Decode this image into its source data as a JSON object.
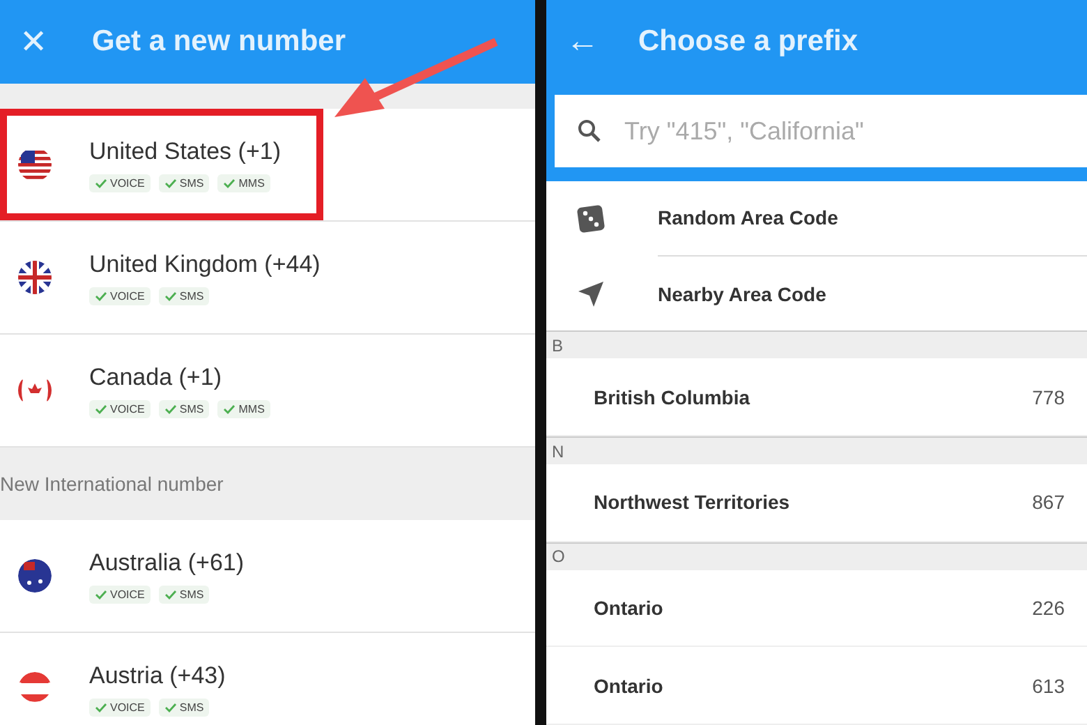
{
  "left_screen": {
    "title": "Get a new number",
    "close_icon": "✕",
    "sections": [
      {
        "countries": [
          {
            "name": "United States (+1)",
            "kind": "us",
            "highlighted": true,
            "features": [
              "VOICE",
              "SMS",
              "MMS"
            ]
          },
          {
            "name": "United Kingdom (+44)",
            "kind": "uk",
            "highlighted": false,
            "features": [
              "VOICE",
              "SMS"
            ]
          },
          {
            "name": "Canada (+1)",
            "kind": "ca",
            "highlighted": false,
            "features": [
              "VOICE",
              "SMS",
              "MMS"
            ]
          }
        ]
      },
      {
        "heading": "New International number",
        "countries": [
          {
            "name": "Australia (+61)",
            "kind": "au",
            "highlighted": false,
            "features": [
              "VOICE",
              "SMS"
            ]
          },
          {
            "name": "Austria (+43)",
            "kind": "at",
            "highlighted": false,
            "features": [
              "VOICE",
              "SMS"
            ]
          }
        ]
      }
    ]
  },
  "right_screen": {
    "title": "Choose a prefix",
    "back_icon": "←",
    "search": {
      "placeholder": "Try \"415\", \"California\""
    },
    "options": [
      {
        "kind": "random",
        "label": "Random Area Code"
      },
      {
        "kind": "nearby",
        "label": "Nearby Area Code"
      }
    ],
    "groups": [
      {
        "letter": "B",
        "regions": [
          {
            "name": "British Columbia",
            "code": "778"
          }
        ]
      },
      {
        "letter": "N",
        "regions": [
          {
            "name": "Northwest Territories",
            "code": "867"
          }
        ]
      },
      {
        "letter": "O",
        "regions": [
          {
            "name": "Ontario",
            "code": "226"
          },
          {
            "name": "Ontario",
            "code": "613"
          }
        ]
      }
    ]
  }
}
